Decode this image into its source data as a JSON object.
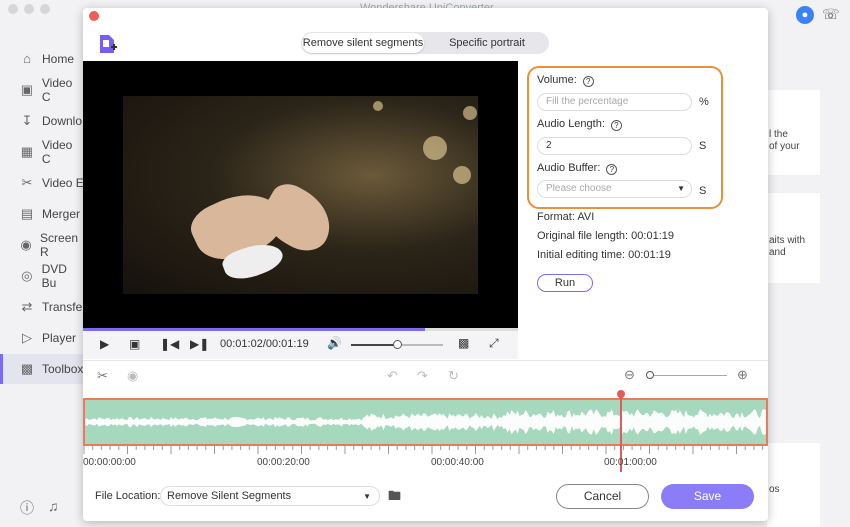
{
  "app": {
    "title": "Wondershare UniConverter"
  },
  "sidebar": {
    "items": [
      {
        "label": "Home",
        "icon": "home-icon"
      },
      {
        "label": "Video C",
        "icon": "video-convert-icon"
      },
      {
        "label": "Downlo",
        "icon": "download-icon"
      },
      {
        "label": "Video C",
        "icon": "video-compress-icon"
      },
      {
        "label": "Video E",
        "icon": "video-edit-icon"
      },
      {
        "label": "Merger",
        "icon": "merger-icon"
      },
      {
        "label": "Screen R",
        "icon": "screen-recorder-icon"
      },
      {
        "label": "DVD Bu",
        "icon": "dvd-burner-icon"
      },
      {
        "label": "Transfe",
        "icon": "transfer-icon"
      },
      {
        "label": "Player",
        "icon": "player-icon"
      },
      {
        "label": "Toolbox",
        "icon": "toolbox-icon"
      }
    ],
    "active_index": 10
  },
  "background": {
    "snip1": "l the",
    "snip2": "of your",
    "snip3": "aits with",
    "snip4": "and",
    "snip5": "os"
  },
  "dialog": {
    "tabs": [
      {
        "label": "Remove silent segments",
        "selected": true
      },
      {
        "label": "Specific portrait",
        "selected": false
      }
    ],
    "player": {
      "time": "00:01:02/00:01:19",
      "progress": 0.786,
      "volume": 0.5
    },
    "settings": {
      "volume_label": "Volume:",
      "volume_placeholder": "Fill the percentage",
      "volume_unit": "%",
      "audio_length_label": "Audio Length:",
      "audio_length_value": "2",
      "audio_length_unit": "S",
      "audio_buffer_label": "Audio Buffer:",
      "audio_buffer_placeholder": "Please choose",
      "audio_buffer_unit": "S"
    },
    "info": {
      "format": "Format: AVI",
      "original_length": "Original file length: 00:01:19",
      "editing_time": "Initial editing time: 00:01:19"
    },
    "run_label": "Run",
    "timeline": {
      "ticks": [
        "00:00:00:00",
        "00:00:20:00",
        "00:00:40:00",
        "00:01:00:00"
      ]
    },
    "footer": {
      "file_location_label": "File Location:",
      "file_location_value": "Remove Silent Segments",
      "cancel_label": "Cancel",
      "save_label": "Save"
    }
  },
  "colors": {
    "accent": "#8b7cf6",
    "highlight": "#e8913a",
    "wave": "#a6d8bd",
    "playhead": "#e45a5a"
  }
}
